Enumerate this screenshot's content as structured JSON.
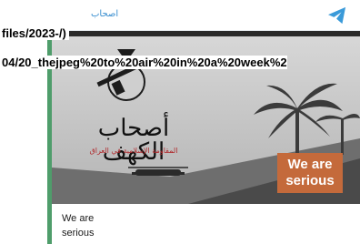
{
  "channel": {
    "name": "اصحاب",
    "icon": "telegram-icon",
    "accent_color": "#4f9d6b"
  },
  "media": {
    "emblem_title": "أصحاب الكهف",
    "emblem_subtitle": "المقاومة الإسلامية في العراق",
    "slogan": "We are serious",
    "slogan_color": "#c46a3b"
  },
  "caption": "We are serious",
  "broken_image": {
    "url_line_1": "files/2023-/)",
    "url_line_2": "04/20_thejpeg%20to%20air%20in%20a%20week%2"
  }
}
